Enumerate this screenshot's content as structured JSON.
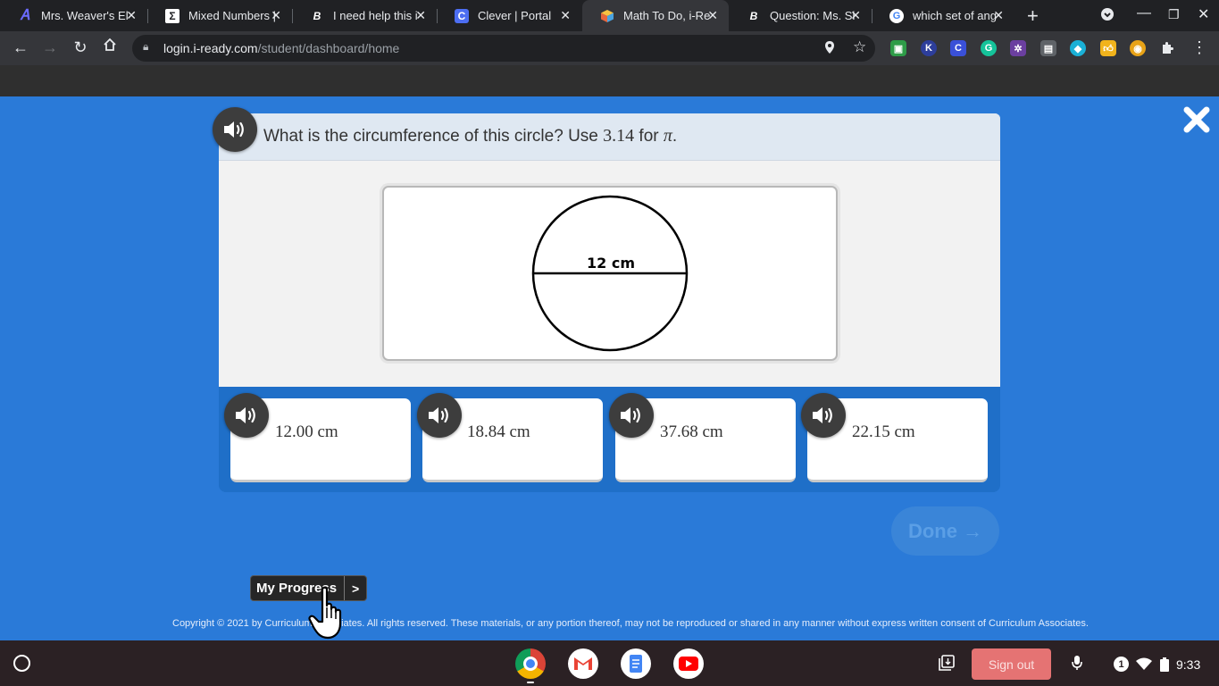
{
  "browser": {
    "tabs": [
      {
        "title": "Mrs. Weaver's El",
        "favicon": "A",
        "favicon_color": "#6b6bff"
      },
      {
        "title": "Mixed Numbers |",
        "favicon": "Σ",
        "favicon_color": "#ffffff"
      },
      {
        "title": "I need help this i",
        "favicon": "B",
        "favicon_color": "#ffffff"
      },
      {
        "title": "Clever | Portal",
        "favicon": "C",
        "favicon_color": "#4d6ef2"
      },
      {
        "title": "Math To Do, i-Re",
        "favicon": "cube",
        "favicon_color": "#f39c12"
      },
      {
        "title": "Question: Ms. Si",
        "favicon": "B",
        "favicon_color": "#ffffff"
      },
      {
        "title": "which set of ang",
        "favicon": "G",
        "favicon_color": "#4285f4"
      }
    ],
    "active_tab": 4,
    "url_host": "login.i-ready.com",
    "url_path": "/student/dashboard/home"
  },
  "question": {
    "prefix": "What is the circumference of this circle? Use",
    "pi_value": "3.14",
    "for_word": "for",
    "pi_symbol": "π",
    "period": ".",
    "diameter_label": "12 cm"
  },
  "choices": [
    {
      "value": "12.00 cm"
    },
    {
      "value": "18.84 cm"
    },
    {
      "value": "37.68 cm"
    },
    {
      "value": "22.15 cm"
    }
  ],
  "done_label": "Done",
  "done_arrow": "→",
  "progress": {
    "label": "My Progress",
    "arrow": ">"
  },
  "copyright": "Copyright © 2021 by Curriculum Associates. All rights reserved. These materials, or any portion thereof, may not be reproduced or shared in any manner without express written consent of Curriculum Associates.",
  "shelf": {
    "signout_label": "Sign out",
    "notification_count": "1",
    "time": "9:33"
  },
  "colors": {
    "page_bg": "#2a7ad8",
    "answer_bar": "#1f6fc8",
    "speaker": "#3d3d3d",
    "signout": "#e57373"
  }
}
